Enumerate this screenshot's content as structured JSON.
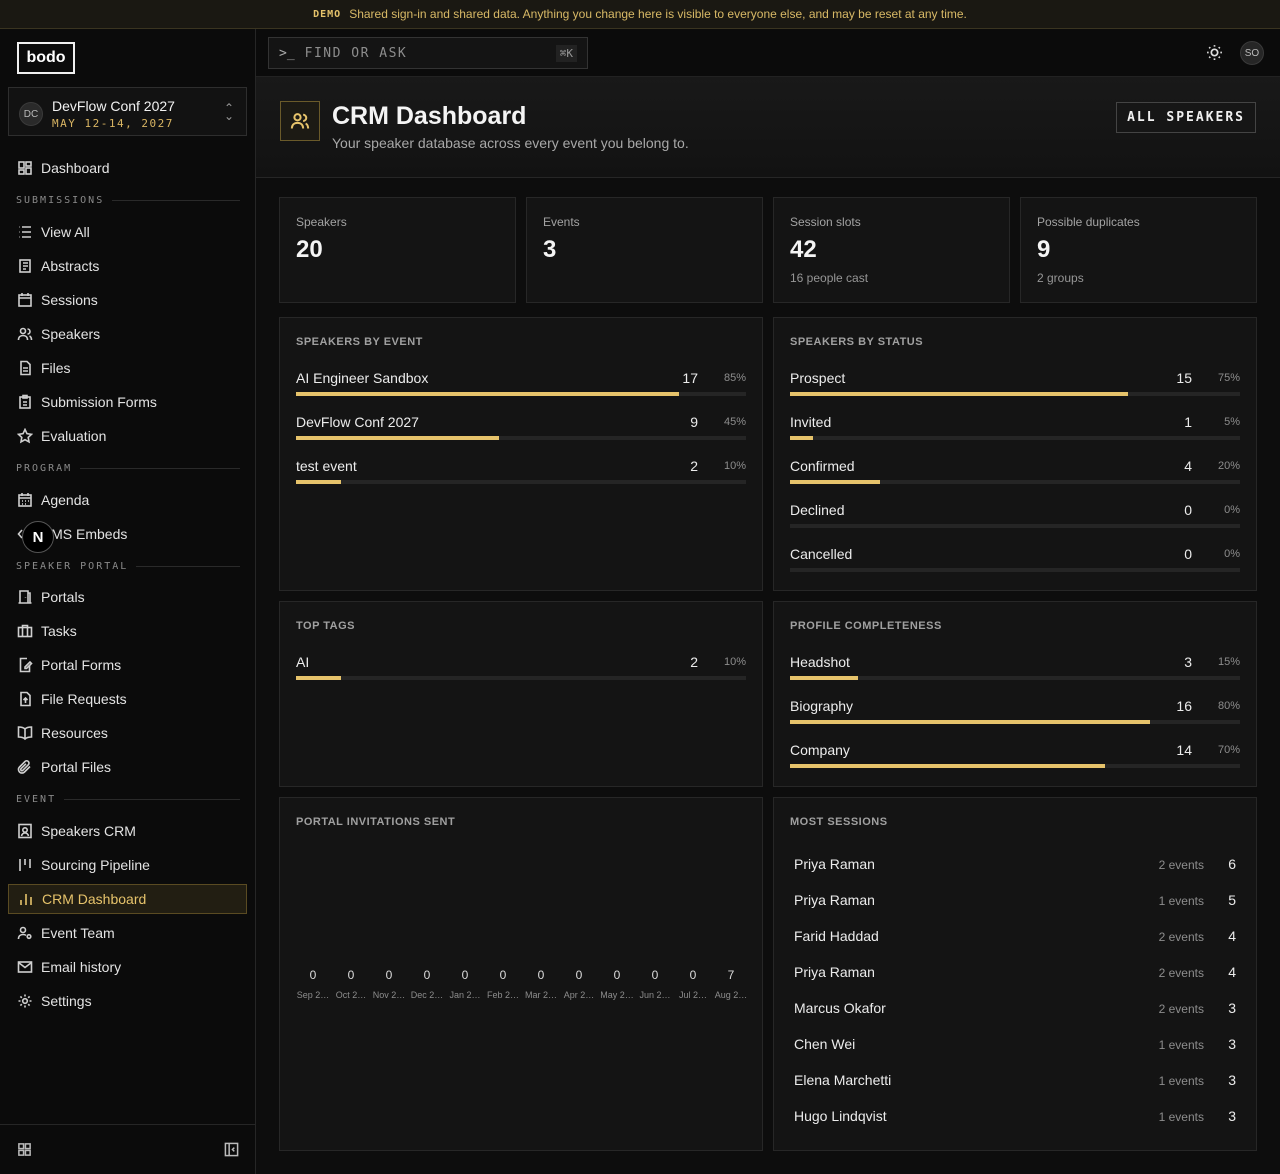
{
  "banner": {
    "tag": "DEMO",
    "text": "Shared sign-in and shared data. Anything you change here is visible to everyone else, and may be reset at any time."
  },
  "sidebar": {
    "logo": "bodo",
    "event": {
      "initials": "DC",
      "name": "DevFlow Conf 2027",
      "dates": "MAY 12-14, 2027"
    },
    "dashboard": "Dashboard",
    "sections": {
      "submissions": "SUBMISSIONS",
      "program": "PROGRAM",
      "speaker_portal": "SPEAKER PORTAL",
      "event": "EVENT"
    },
    "submissions_items": [
      "View All",
      "Abstracts",
      "Sessions",
      "Speakers",
      "Files",
      "Submission Forms",
      "Evaluation"
    ],
    "program_items": [
      "Agenda",
      "CMS Embeds"
    ],
    "portal_items": [
      "Portals",
      "Tasks",
      "Portal Forms",
      "File Requests",
      "Resources",
      "Portal Files"
    ],
    "event_items": [
      "Speakers CRM",
      "Sourcing Pipeline",
      "CRM Dashboard",
      "Event Team",
      "Email history",
      "Settings"
    ],
    "active_item": "CRM Dashboard",
    "overlay_badge": "N"
  },
  "topbar": {
    "search_prompt": ">_",
    "search_placeholder": "FIND OR ASK",
    "search_shortcut": "⌘K",
    "user_initials": "SO"
  },
  "header": {
    "title": "CRM Dashboard",
    "subtitle": "Your speaker database across every event you belong to.",
    "button": "ALL SPEAKERS"
  },
  "stats": [
    {
      "label": "Speakers",
      "value": "20",
      "note": ""
    },
    {
      "label": "Events",
      "value": "3",
      "note": ""
    },
    {
      "label": "Session slots",
      "value": "42",
      "note": "16 people cast"
    },
    {
      "label": "Possible duplicates",
      "value": "9",
      "note": "2 groups"
    }
  ],
  "colors": {
    "accent": "#e6c36b",
    "background": "#0d0d0d",
    "card": "#141414"
  },
  "speakers_by_event": {
    "title": "SPEAKERS BY EVENT",
    "rows": [
      {
        "label": "AI Engineer Sandbox",
        "count": "17",
        "pct": "85%",
        "fraction": 0.85
      },
      {
        "label": "DevFlow Conf 2027",
        "count": "9",
        "pct": "45%",
        "fraction": 0.45
      },
      {
        "label": "test event",
        "count": "2",
        "pct": "10%",
        "fraction": 0.1
      }
    ]
  },
  "speakers_by_status": {
    "title": "SPEAKERS BY STATUS",
    "rows": [
      {
        "label": "Prospect",
        "count": "15",
        "pct": "75%",
        "fraction": 0.75
      },
      {
        "label": "Invited",
        "count": "1",
        "pct": "5%",
        "fraction": 0.05
      },
      {
        "label": "Confirmed",
        "count": "4",
        "pct": "20%",
        "fraction": 0.2
      },
      {
        "label": "Declined",
        "count": "0",
        "pct": "0%",
        "fraction": 0
      },
      {
        "label": "Cancelled",
        "count": "0",
        "pct": "0%",
        "fraction": 0
      }
    ]
  },
  "top_tags": {
    "title": "TOP TAGS",
    "rows": [
      {
        "label": "AI",
        "count": "2",
        "pct": "10%",
        "fraction": 0.1
      }
    ]
  },
  "profile_completeness": {
    "title": "PROFILE COMPLETENESS",
    "rows": [
      {
        "label": "Headshot",
        "count": "3",
        "pct": "15%",
        "fraction": 0.15
      },
      {
        "label": "Biography",
        "count": "16",
        "pct": "80%",
        "fraction": 0.8
      },
      {
        "label": "Company",
        "count": "14",
        "pct": "70%",
        "fraction": 0.7
      }
    ]
  },
  "portal_invitations": {
    "title": "PORTAL INVITATIONS SENT",
    "months": [
      {
        "label": "Sep 2…",
        "value": "0"
      },
      {
        "label": "Oct 2…",
        "value": "0"
      },
      {
        "label": "Nov 2…",
        "value": "0"
      },
      {
        "label": "Dec 2…",
        "value": "0"
      },
      {
        "label": "Jan 2…",
        "value": "0"
      },
      {
        "label": "Feb 2…",
        "value": "0"
      },
      {
        "label": "Mar 2…",
        "value": "0"
      },
      {
        "label": "Apr 2…",
        "value": "0"
      },
      {
        "label": "May 2…",
        "value": "0"
      },
      {
        "label": "Jun 2…",
        "value": "0"
      },
      {
        "label": "Jul 2…",
        "value": "0"
      },
      {
        "label": "Aug 2…",
        "value": "7"
      }
    ]
  },
  "most_sessions": {
    "title": "MOST SESSIONS",
    "rows": [
      {
        "name": "Priya Raman",
        "events": "2 events",
        "count": "6"
      },
      {
        "name": "Priya Raman",
        "events": "1 events",
        "count": "5"
      },
      {
        "name": "Farid Haddad",
        "events": "2 events",
        "count": "4"
      },
      {
        "name": "Priya Raman",
        "events": "2 events",
        "count": "4"
      },
      {
        "name": "Marcus Okafor",
        "events": "2 events",
        "count": "3"
      },
      {
        "name": "Chen Wei",
        "events": "1 events",
        "count": "3"
      },
      {
        "name": "Elena Marchetti",
        "events": "1 events",
        "count": "3"
      },
      {
        "name": "Hugo Lindqvist",
        "events": "1 events",
        "count": "3"
      }
    ]
  }
}
